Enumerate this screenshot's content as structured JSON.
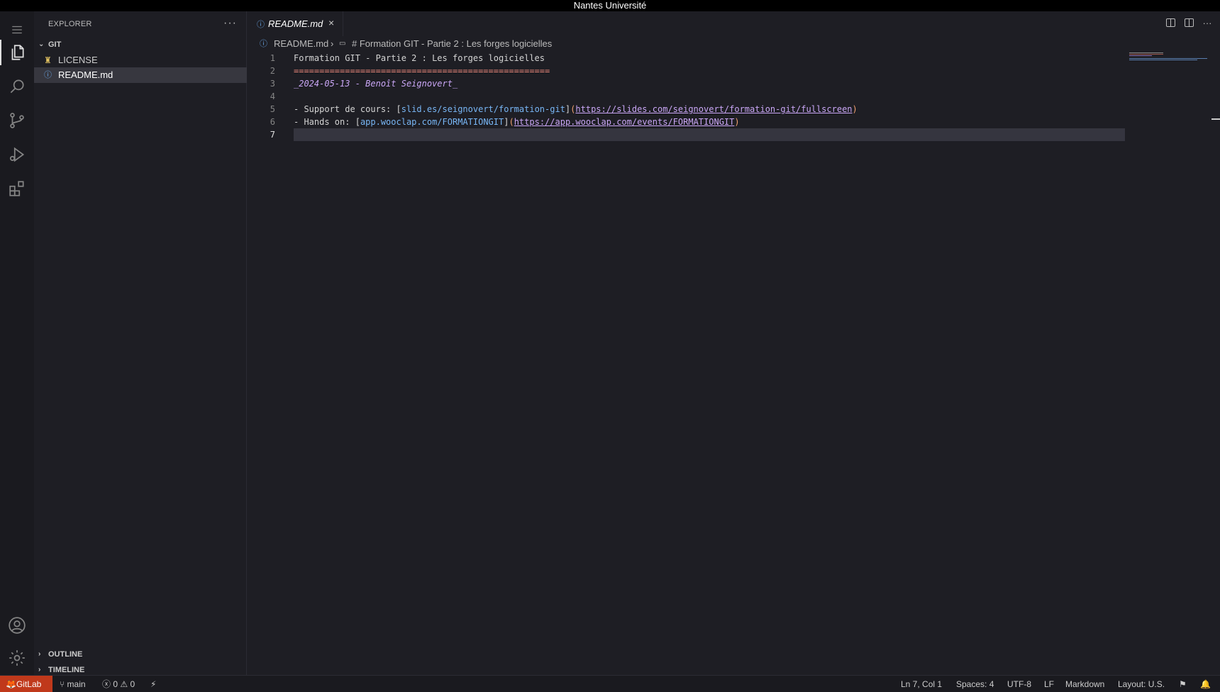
{
  "titlebar": {
    "title": "Nantes Université"
  },
  "activity": {
    "items": [
      {
        "name": "explorer",
        "icon": "files-icon"
      },
      {
        "name": "search",
        "icon": "search-icon"
      },
      {
        "name": "source-control",
        "icon": "source-control-icon"
      },
      {
        "name": "run-debug",
        "icon": "run-debug-icon"
      },
      {
        "name": "extensions",
        "icon": "extensions-icon"
      }
    ],
    "bottom": [
      {
        "name": "accounts",
        "icon": "account-icon"
      },
      {
        "name": "manage",
        "icon": "gear-icon"
      }
    ]
  },
  "sidebar": {
    "title": "EXPLORER",
    "more": "···",
    "folder": "GIT",
    "files": [
      {
        "label": "LICENSE",
        "icon": "license-icon"
      },
      {
        "label": "README.md",
        "icon": "info-icon",
        "selected": true
      }
    ],
    "outline": "OUTLINE",
    "timeline": "TIMELINE"
  },
  "editor": {
    "tab": {
      "label": "README.md",
      "close": "×"
    },
    "breadcrumb": {
      "file": "README.md",
      "separator": "›",
      "symbol": "# Formation GIT - Partie 2 : Les forges logicielles"
    },
    "lines": {
      "l1": "Formation GIT - Partie 2 : Les forges logicielles",
      "l2": "==================================================",
      "l3": "_2024-05-13 - Benoît Seignovert_",
      "l4": "",
      "l5_prefix": "- Support de cours: ",
      "l5_link_text": "slid.es/seignovert/formation-git",
      "l5_url": "https://slides.com/seignovert/formation-git/fullscreen",
      "l6_prefix": "- Hands on: ",
      "l6_link_text": "app.wooclap.com/FORMATIONGIT",
      "l6_url": "https://app.wooclap.com/events/FORMATIONGIT",
      "l7": ""
    },
    "line_numbers": [
      "1",
      "2",
      "3",
      "4",
      "5",
      "6",
      "7"
    ]
  },
  "statusbar": {
    "remote": "GitLab",
    "branch": "main",
    "errors": "0",
    "warnings": "0",
    "position": "Ln 7, Col 1",
    "spaces": "Spaces: 4",
    "encoding": "UTF-8",
    "eol": "LF",
    "language": "Markdown",
    "layout": "Layout: U.S."
  },
  "colors": {
    "accent_remote": "#c0391b",
    "background": "#1e1e24",
    "heading_rule": "#f08a7c",
    "link": "#78b6f5",
    "url": "#c9a6f5"
  }
}
